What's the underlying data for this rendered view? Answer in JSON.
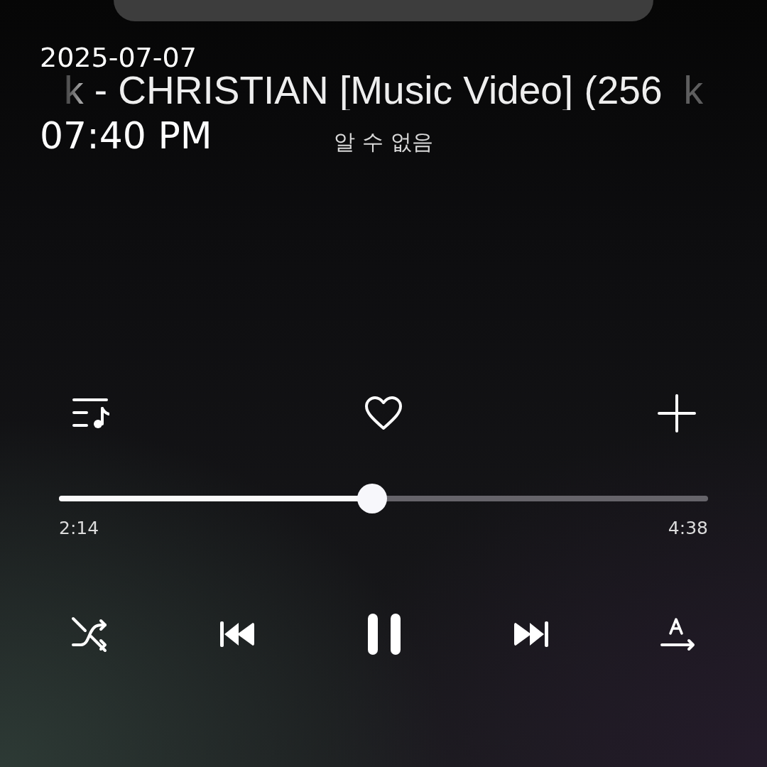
{
  "timestamp": {
    "date": "2025-07-07",
    "time": "07:40 PM"
  },
  "track": {
    "title": "k - CHRISTIAN [Music Video] (256",
    "title_next": "k",
    "artist": "알 수 없음",
    "liked": false
  },
  "progress": {
    "level": 0.482,
    "elapsed": "2:14",
    "total": "4:38"
  },
  "player": {
    "playing": true
  }
}
